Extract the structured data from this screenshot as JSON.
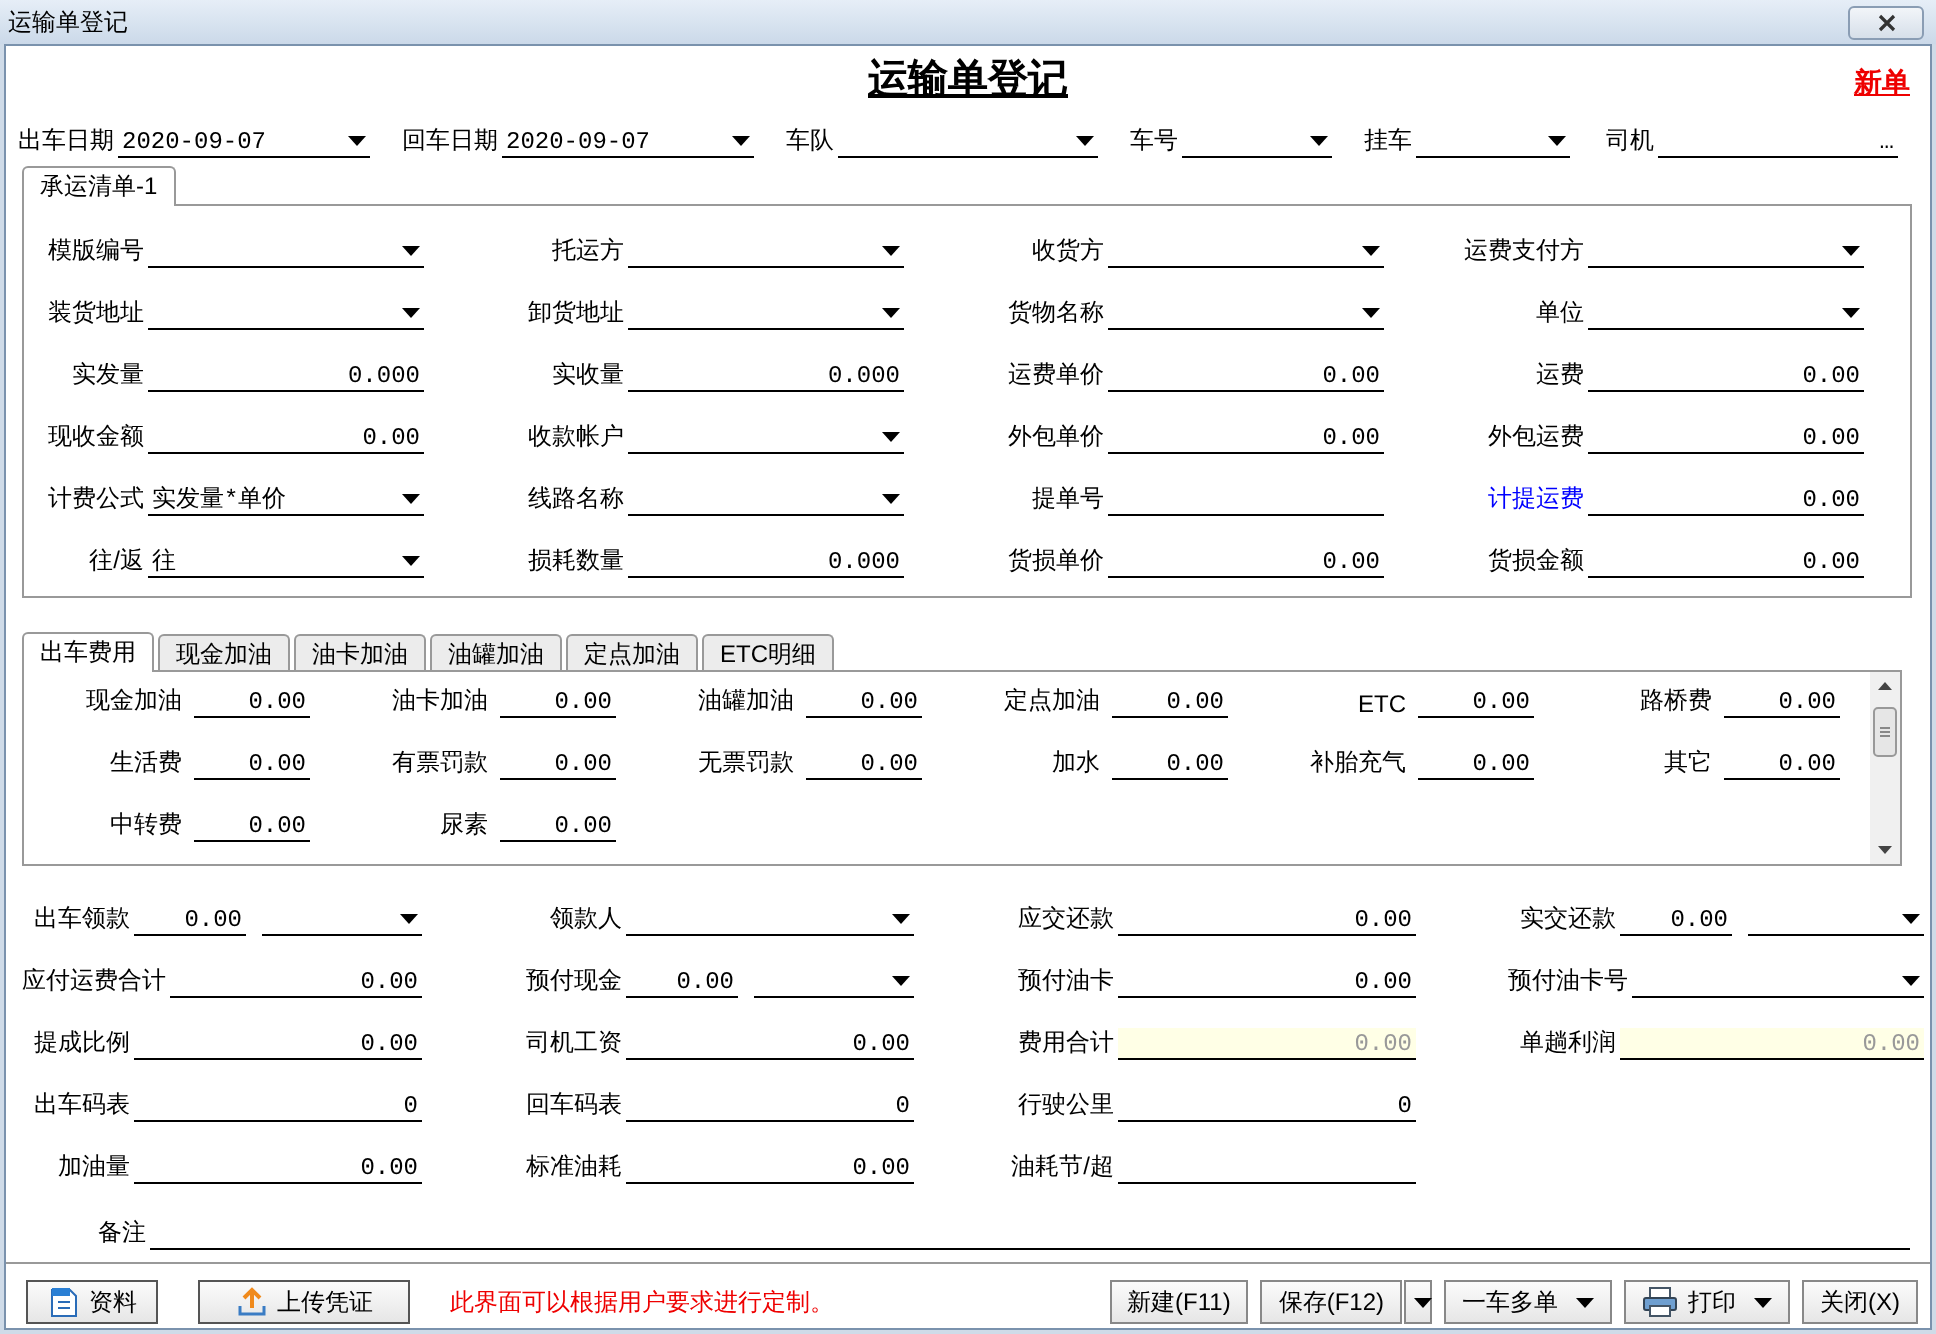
{
  "window": {
    "title": "运输单登记"
  },
  "header": {
    "title": "运输单登记",
    "status": "新单"
  },
  "top_fields": [
    {
      "label": "出车日期",
      "value": "2020-09-07",
      "kind": "combo"
    },
    {
      "label": "回车日期",
      "value": "2020-09-07",
      "kind": "combo"
    },
    {
      "label": "车队",
      "kind": "combo"
    },
    {
      "label": "车号",
      "kind": "combo"
    },
    {
      "label": "挂车",
      "kind": "combo"
    },
    {
      "label": "司机",
      "kind": "picker",
      "button_text": "…"
    }
  ],
  "cargo_tabs": [
    {
      "label": "承运清单-1",
      "selected": true
    }
  ],
  "cargo_fields": [
    {
      "label": "模版编号",
      "kind": "combo",
      "link": false
    },
    {
      "label": "托运方",
      "kind": "combo",
      "link": false
    },
    {
      "label": "收货方",
      "kind": "combo",
      "link": false
    },
    {
      "label": "运费支付方",
      "kind": "combo",
      "link": false
    },
    {
      "label": "装货地址",
      "kind": "combo",
      "link": false
    },
    {
      "label": "卸货地址",
      "kind": "combo",
      "link": false
    },
    {
      "label": "货物名称",
      "kind": "combo",
      "link": false
    },
    {
      "label": "单位",
      "kind": "combo",
      "link": false
    },
    {
      "label": "实发量",
      "kind": "text",
      "value": "0.000",
      "link": false
    },
    {
      "label": "实收量",
      "kind": "text",
      "value": "0.000",
      "link": false
    },
    {
      "label": "运费单价",
      "kind": "text",
      "value": "0.00",
      "link": false
    },
    {
      "label": "运费",
      "kind": "text",
      "value": "0.00",
      "link": false
    },
    {
      "label": "现收金额",
      "kind": "text",
      "value": "0.00",
      "link": false
    },
    {
      "label": "收款帐户",
      "kind": "combo",
      "link": false
    },
    {
      "label": "外包单价",
      "kind": "text",
      "value": "0.00",
      "link": false
    },
    {
      "label": "外包运费",
      "kind": "text",
      "value": "0.00",
      "link": false
    },
    {
      "label": "计费公式",
      "kind": "combo",
      "value": "实发量*单价",
      "link": false
    },
    {
      "label": "线路名称",
      "kind": "combo",
      "link": false
    },
    {
      "label": "提单号",
      "kind": "text",
      "link": false
    },
    {
      "label": "计提运费",
      "kind": "text",
      "value": "0.00",
      "link": true
    },
    {
      "label": "往/返",
      "kind": "combo",
      "value": "往",
      "link": false
    },
    {
      "label": "损耗数量",
      "kind": "text",
      "value": "0.000",
      "link": false
    },
    {
      "label": "货损单价",
      "kind": "text",
      "value": "0.00",
      "link": false
    },
    {
      "label": "货损金额",
      "kind": "text",
      "value": "0.00",
      "link": false
    }
  ],
  "expense_tabs": [
    {
      "label": "出车费用",
      "selected": true
    },
    {
      "label": "现金加油",
      "selected": false
    },
    {
      "label": "油卡加油",
      "selected": false
    },
    {
      "label": "油罐加油",
      "selected": false
    },
    {
      "label": "定点加油",
      "selected": false
    },
    {
      "label": "ETC明细",
      "selected": false
    }
  ],
  "expense_fields": [
    {
      "label": "现金加油",
      "value": "0.00"
    },
    {
      "label": "油卡加油",
      "value": "0.00"
    },
    {
      "label": "油罐加油",
      "value": "0.00"
    },
    {
      "label": "定点加油",
      "value": "0.00"
    },
    {
      "label": "ETC",
      "value": "0.00"
    },
    {
      "label": "路桥费",
      "value": "0.00"
    },
    {
      "label": "生活费",
      "value": "0.00"
    },
    {
      "label": "有票罚款",
      "value": "0.00"
    },
    {
      "label": "无票罚款",
      "value": "0.00"
    },
    {
      "label": "加水",
      "value": "0.00"
    },
    {
      "label": "补胎充气",
      "value": "0.00"
    },
    {
      "label": "其它",
      "value": "0.00"
    },
    {
      "label": "中转费",
      "value": "0.00"
    },
    {
      "label": "尿素",
      "value": "0.00"
    }
  ],
  "summary_rows": [
    [
      {
        "label": "出车领款",
        "kind": "split",
        "value": "0.00"
      },
      {
        "label": "领款人",
        "kind": "combo"
      },
      {
        "label": "应交还款",
        "kind": "text",
        "value": "0.00"
      },
      {
        "label": "实交还款",
        "kind": "split",
        "value": "0.00"
      }
    ],
    [
      {
        "label": "应付运费合计",
        "kind": "text",
        "value": "0.00"
      },
      {
        "label": "预付现金",
        "kind": "split",
        "value": "0.00"
      },
      {
        "label": "预付油卡",
        "kind": "text",
        "value": "0.00"
      },
      {
        "label": "预付油卡号",
        "kind": "combo"
      }
    ],
    [
      {
        "label": "提成比例",
        "kind": "text",
        "value": "0.00"
      },
      {
        "label": "司机工资",
        "kind": "text",
        "value": "0.00"
      },
      {
        "label": "费用合计",
        "kind": "readonly",
        "value": "0.00"
      },
      {
        "label": "单趟利润",
        "kind": "readonly",
        "value": "0.00"
      }
    ],
    [
      {
        "label": "出车码表",
        "kind": "text",
        "value": "0"
      },
      {
        "label": "回车码表",
        "kind": "text",
        "value": "0"
      },
      {
        "label": "行驶公里",
        "kind": "text",
        "value": "0"
      }
    ],
    [
      {
        "label": "加油量",
        "kind": "text",
        "value": "0.00"
      },
      {
        "label": "标准油耗",
        "kind": "text",
        "value": "0.00"
      },
      {
        "label": "油耗节/超",
        "kind": "text"
      }
    ]
  ],
  "remark": {
    "label": "备注"
  },
  "footer": {
    "left_buttons": [
      {
        "label": "资料",
        "kind": "doc"
      },
      {
        "label": "上传凭证",
        "kind": "upload"
      }
    ],
    "notice": "此界面可以根据用户要求进行定制。",
    "right_buttons": [
      {
        "label": "新建(F11)",
        "kind": "plain"
      },
      {
        "label": "保存(F12)",
        "kind": "split"
      },
      {
        "label": "一车多单",
        "kind": "menu"
      },
      {
        "label": "打印",
        "kind": "print"
      },
      {
        "label": "关闭(X)",
        "kind": "plain"
      }
    ]
  }
}
